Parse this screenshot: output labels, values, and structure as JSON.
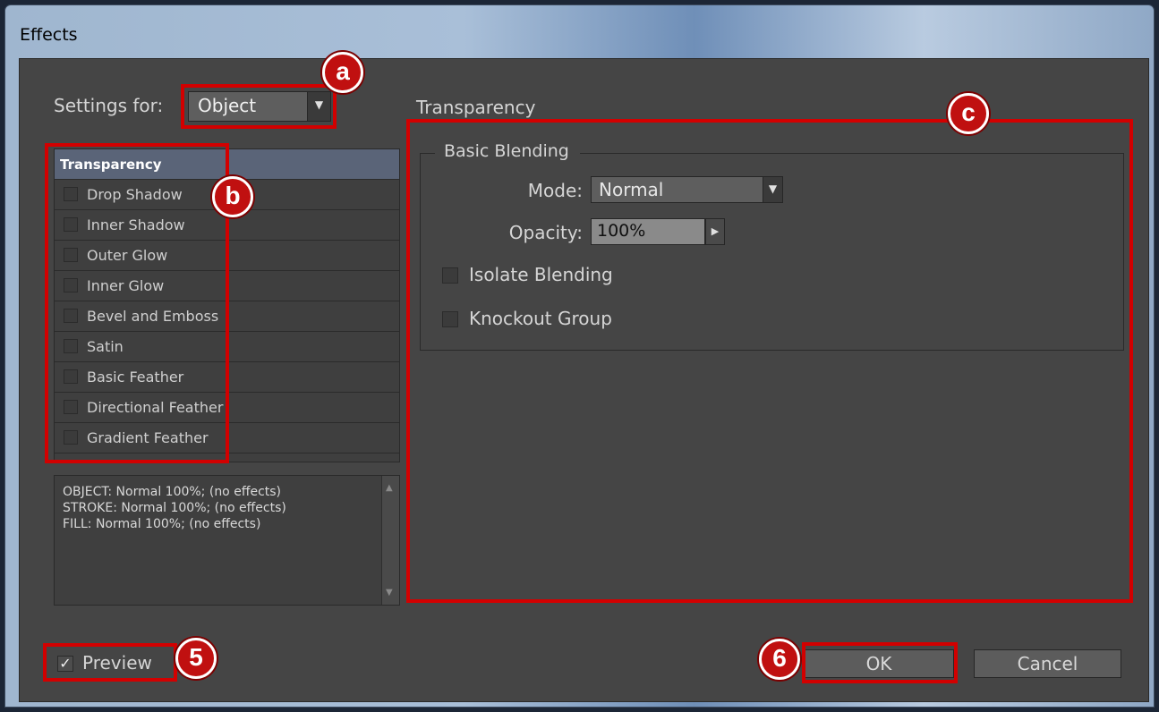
{
  "window": {
    "title": "Effects"
  },
  "settings": {
    "label": "Settings for:",
    "value": "Object"
  },
  "effects_list": {
    "header": "Transparency",
    "items": [
      "Drop Shadow",
      "Inner Shadow",
      "Outer Glow",
      "Inner Glow",
      "Bevel and Emboss",
      "Satin",
      "Basic Feather",
      "Directional Feather",
      "Gradient Feather"
    ]
  },
  "summary": [
    "OBJECT: Normal 100%; (no effects)",
    "STROKE: Normal 100%; (no effects)",
    "FILL: Normal 100%; (no effects)"
  ],
  "panel": {
    "title": "Transparency",
    "group_title": "Basic Blending",
    "mode_label": "Mode:",
    "mode_value": "Normal",
    "opacity_label": "Opacity:",
    "opacity_value": "100%",
    "isolate_label": "Isolate Blending",
    "knockout_label": "Knockout Group"
  },
  "footer": {
    "preview_label": "Preview",
    "ok_label": "OK",
    "cancel_label": "Cancel"
  },
  "callouts": {
    "a": "a",
    "b": "b",
    "c": "c",
    "five": "5",
    "six": "6"
  },
  "icons": {
    "dropdown": "triangle-down-icon",
    "stepper": "triangle-right-icon",
    "scroll_up": "arrow-up-icon",
    "scroll_down": "arrow-down-icon",
    "check": "checkmark-icon"
  },
  "colors": {
    "annotation_red": "#d20000",
    "dialog_bg": "#454545",
    "list_header": "#5a6478"
  }
}
